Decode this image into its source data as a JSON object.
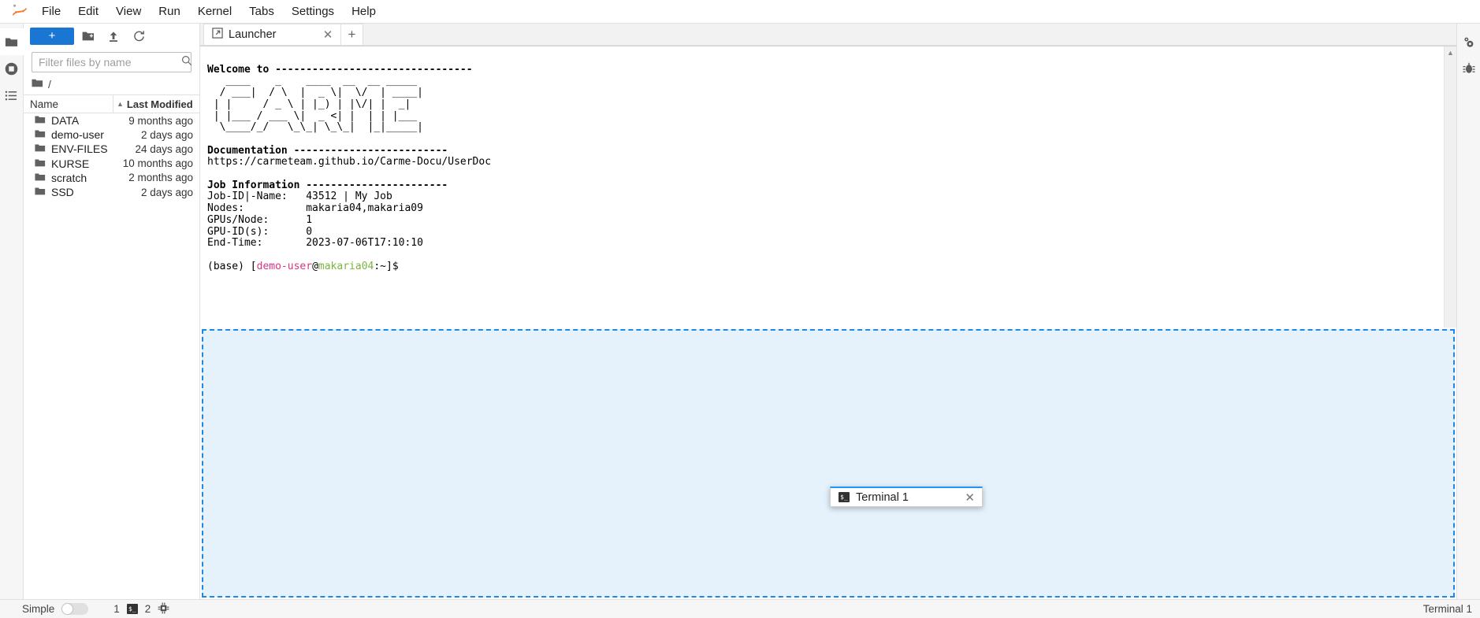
{
  "app": {
    "logo_icon": "jupyter-logo-icon"
  },
  "menubar": {
    "items": [
      {
        "label": "File"
      },
      {
        "label": "Edit"
      },
      {
        "label": "View"
      },
      {
        "label": "Run"
      },
      {
        "label": "Kernel"
      },
      {
        "label": "Tabs"
      },
      {
        "label": "Settings"
      },
      {
        "label": "Help"
      }
    ]
  },
  "left_activity_bar": {
    "items": [
      {
        "name": "file-browser-icon",
        "title": "File Browser"
      },
      {
        "name": "running-sessions-icon",
        "title": "Running Terminals and Kernels"
      },
      {
        "name": "table-of-contents-icon",
        "title": "Table of Contents"
      }
    ]
  },
  "right_activity_bar": {
    "items": [
      {
        "name": "property-inspector-icon",
        "title": "Property Inspector"
      },
      {
        "name": "debugger-icon",
        "title": "Debugger"
      }
    ]
  },
  "file_browser": {
    "toolbar": {
      "new_launcher_label": "+",
      "new_folder_icon": "new-folder-icon",
      "upload_icon": "upload-icon",
      "refresh_icon": "refresh-icon"
    },
    "filter": {
      "value": "",
      "placeholder": "Filter files by name",
      "search_icon": "search-icon"
    },
    "breadcrumb": {
      "root_icon": "folder-icon",
      "path": "/"
    },
    "columns": {
      "name": "Name",
      "last_modified": "Last Modified",
      "sort_indicator": "▲"
    },
    "rows": [
      {
        "name": "DATA",
        "modified": "9 months ago"
      },
      {
        "name": "demo-user",
        "modified": "2 days ago"
      },
      {
        "name": "ENV-FILES",
        "modified": "24 days ago"
      },
      {
        "name": "KURSE",
        "modified": "10 months ago"
      },
      {
        "name": "scratch",
        "modified": "2 months ago"
      },
      {
        "name": "SSD",
        "modified": "2 days ago"
      }
    ]
  },
  "dock": {
    "tabs": [
      {
        "label": "Launcher",
        "icon": "launcher-icon",
        "close_icon": "✕"
      }
    ],
    "add_tab_label": "+"
  },
  "terminal": {
    "welcome_line": "Welcome to --------------------------------",
    "ascii_art": [
      "   ____    _    ____  __  __ _____ ",
      "  / ___|  / \\  |  _ \\|  \\/  | ____|",
      " | |     / _ \\ | |_) | |\\/| |  _|  ",
      " | |___ / ___ \\|  _ <| |  | | |___ ",
      "  \\____/_/   \\_\\_| \\_\\_|  |_|_____|"
    ],
    "documentation_header": "Documentation -------------------------",
    "documentation_url": "https://carmeteam.github.io/Carme-Docu/UserDoc",
    "job_header": "Job Information -----------------------",
    "job_fields": [
      {
        "key": "Job-ID|-Name:",
        "value": "43512 | My Job"
      },
      {
        "key": "Nodes:",
        "value": "makaria04,makaria09"
      },
      {
        "key": "GPUs/Node:",
        "value": "1"
      },
      {
        "key": "GPU-ID(s):",
        "value": "0"
      },
      {
        "key": "End-Time:",
        "value": "2023-07-06T17:10:10"
      }
    ],
    "prompt": {
      "env": "(base) ",
      "bracket_open": "[",
      "user": "demo-user",
      "at": "@",
      "host": "makaria04",
      "path": ":~",
      "bracket_close": "]",
      "sigil": "$",
      "user_color": "#d33682",
      "host_color": "#7cb342"
    },
    "scrollbar_up_icon": "▲"
  },
  "drag_tab": {
    "label": "Terminal 1",
    "icon": "terminal-icon",
    "icon_glyph": "$_",
    "close_icon": "✕"
  },
  "dropzone": {
    "fill_color": "#e5f2fb",
    "border_color": "#1e88e5"
  },
  "statusbar": {
    "simple_label": "Simple",
    "simple_toggle_on": false,
    "kernel_count": "1",
    "terminal_icon": "terminal-icon",
    "terminal_glyph": "$_",
    "terminal_count": "2",
    "resource_icon": "cpu-icon",
    "active_document": "Terminal 1"
  },
  "colors": {
    "accent": "#1976d2",
    "panel_bg": "#f6f6f6",
    "border": "#e0e0e0"
  }
}
